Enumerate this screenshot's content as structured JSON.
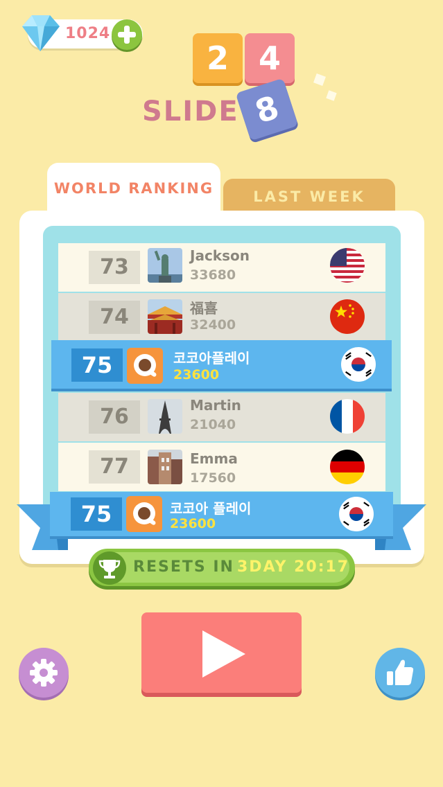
{
  "gems": {
    "count": "1024",
    "icon": "diamond-icon",
    "add_icon": "plus-icon"
  },
  "logo": {
    "tiles": [
      "2",
      "4",
      "8"
    ],
    "word": "SLIDE"
  },
  "tabs": [
    {
      "label": "WORLD RANKING",
      "active": true
    },
    {
      "label": "LAST WEEK",
      "active": false
    }
  ],
  "ranking": [
    {
      "rank": "73",
      "name": "Jackson",
      "score": "33680",
      "avatar": "statue-of-liberty",
      "flag": "usa"
    },
    {
      "rank": "74",
      "name": "福喜",
      "score": "32400",
      "avatar": "forbidden-city",
      "flag": "china"
    },
    {
      "rank": "75",
      "name": "코코아플레이",
      "score": "23600",
      "avatar": "cocoaplay-logo",
      "flag": "korea",
      "is_me": true
    },
    {
      "rank": "76",
      "name": "Martin",
      "score": "21040",
      "avatar": "eiffel-tower",
      "flag": "france"
    },
    {
      "rank": "77",
      "name": "Emma",
      "score": "17560",
      "avatar": "german-town",
      "flag": "germany"
    }
  ],
  "my_rank": {
    "rank": "75",
    "name": "코코아 플레이",
    "score": "23600",
    "flag": "korea"
  },
  "resets": {
    "label": "RESETS IN",
    "time": "3DAY 20:17",
    "icon": "trophy-icon"
  },
  "buttons": {
    "play_icon": "play-icon",
    "settings_icon": "gear-icon",
    "like_icon": "thumbs-up-icon"
  },
  "colors": {
    "background": "#fbeba7",
    "accent_pink": "#fb7e7a",
    "accent_blue": "#5db6ee",
    "accent_green": "#8bc642"
  }
}
